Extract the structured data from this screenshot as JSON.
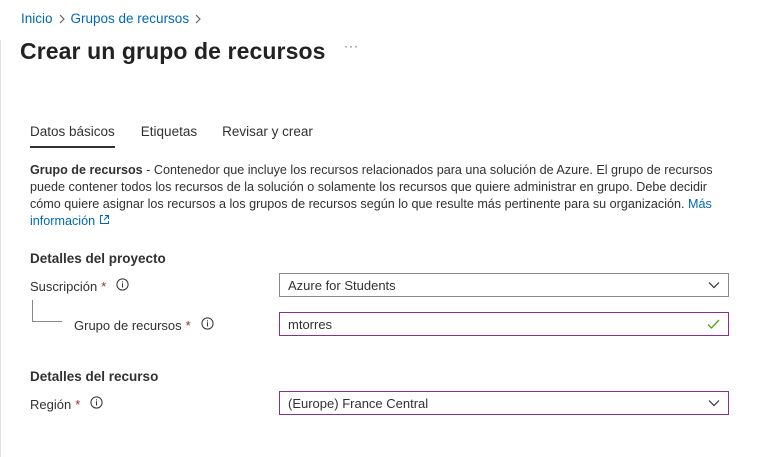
{
  "breadcrumb": {
    "home": "Inicio",
    "resource_groups": "Grupos de recursos"
  },
  "page": {
    "title": "Crear un grupo de recursos",
    "more_label": "···"
  },
  "tabs": [
    {
      "label": "Datos básicos",
      "active": true
    },
    {
      "label": "Etiquetas",
      "active": false
    },
    {
      "label": "Revisar y crear",
      "active": false
    }
  ],
  "description": {
    "term": "Grupo de recursos",
    "text": " - Contenedor que incluye los recursos relacionados para una solución de Azure. El grupo de recursos puede contener todos los recursos de la solución o solamente los recursos que quiere administrar en grupo. Debe decidir cómo quiere asignar los recursos a los grupos de recursos según lo que resulte más pertinente para su organización. ",
    "link": "Más información"
  },
  "project_details": {
    "heading": "Detalles del proyecto",
    "subscription_label": "Suscripción",
    "subscription_value": "Azure for Students",
    "resource_group_label": "Grupo de recursos",
    "resource_group_value": "mtorres"
  },
  "resource_details": {
    "heading": "Detalles del recurso",
    "region_label": "Región",
    "region_value": "(Europe) France Central"
  },
  "required_marker": "*",
  "colors": {
    "link": "#0068b8",
    "required": "#a4262c",
    "valid_border": "#8a2f8f",
    "check": "#57a300"
  },
  "icons": [
    "chevron-right-icon",
    "info-icon",
    "external-link-icon",
    "chevron-down-icon",
    "check-icon"
  ]
}
